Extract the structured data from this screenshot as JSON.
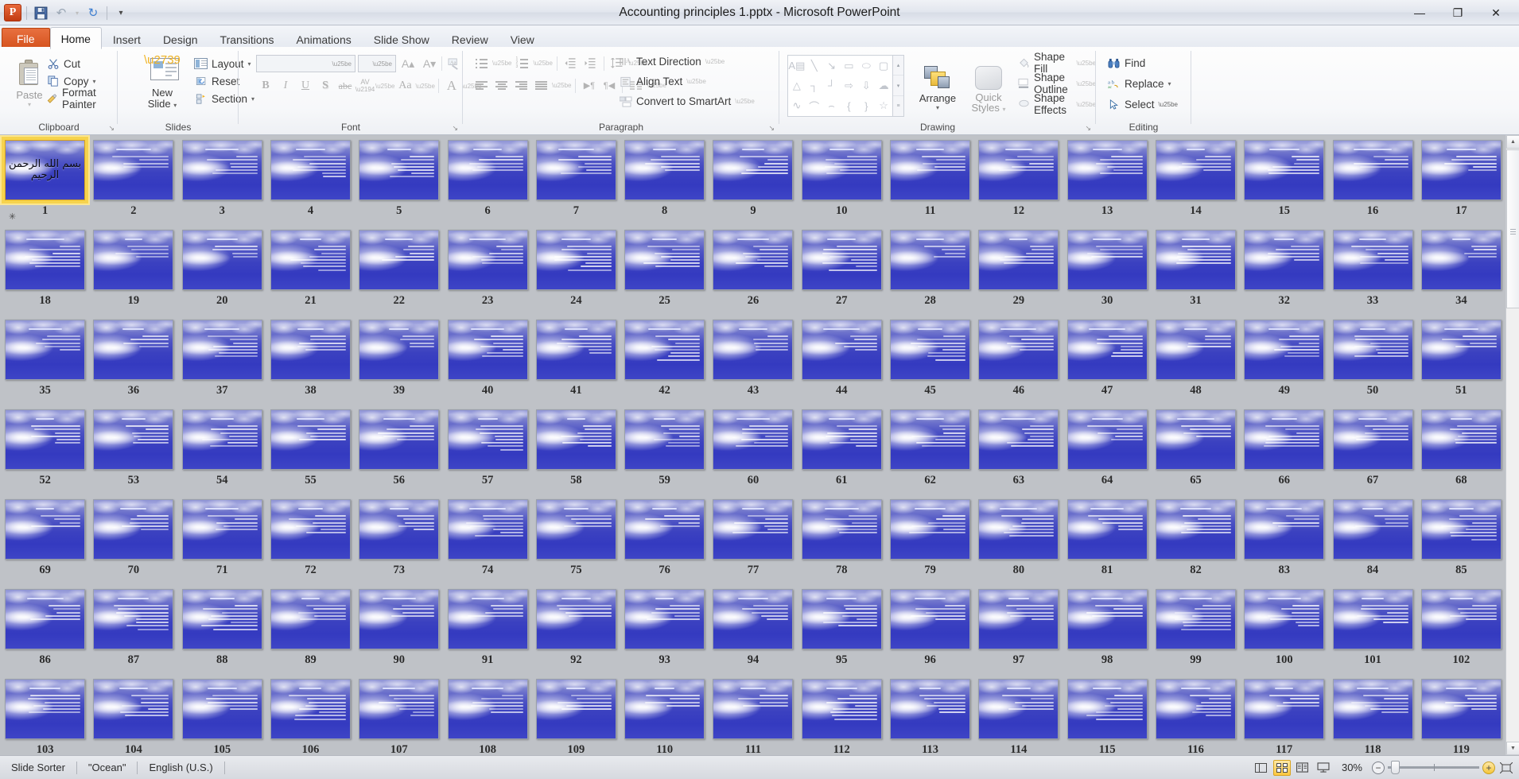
{
  "window": {
    "title": "Accounting principles 1.pptx  -  Microsoft PowerPoint",
    "app_logo": "P",
    "minimize": "—",
    "restore": "❐",
    "close": "✕",
    "ribbon_collapse_icon": "⌃",
    "help_icon": "?"
  },
  "quick_access": {
    "save_icon": "save-icon",
    "undo_icon": "↶",
    "undo_dropdown": "▾",
    "redo_icon": "↻",
    "customize_icon": "▾"
  },
  "tabs": [
    {
      "label": "File",
      "kind": "file"
    },
    {
      "label": "Home",
      "kind": "active"
    },
    {
      "label": "Insert",
      "kind": "normal"
    },
    {
      "label": "Design",
      "kind": "normal"
    },
    {
      "label": "Transitions",
      "kind": "normal"
    },
    {
      "label": "Animations",
      "kind": "normal"
    },
    {
      "label": "Slide Show",
      "kind": "normal"
    },
    {
      "label": "Review",
      "kind": "normal"
    },
    {
      "label": "View",
      "kind": "normal"
    }
  ],
  "ribbon": {
    "clipboard": {
      "group_label": "Clipboard",
      "paste": "Paste",
      "paste_caret": "▾",
      "cut": "Cut",
      "copy": "Copy",
      "copy_caret": "▾",
      "format_painter": "Format Painter",
      "dialog_launcher": "↘"
    },
    "slides": {
      "group_label": "Slides",
      "new_slide_line1": "New",
      "new_slide_line2": "Slide",
      "new_slide_caret": "▾",
      "layout": "Layout",
      "layout_caret": "▾",
      "reset": "Reset",
      "section": "Section",
      "section_caret": "▾"
    },
    "font": {
      "group_label": "Font",
      "font_name_value": "",
      "font_size_value": "",
      "grow_font": "A▴",
      "shrink_font": "A▾",
      "clear_formatting": "clear-formatting-icon",
      "bold": "B",
      "italic": "I",
      "underline": "U",
      "shadow": "S",
      "strikethrough": "abc",
      "character_spacing": "AV",
      "change_case": "Aa",
      "font_color": "A",
      "dialog_launcher": "↘"
    },
    "paragraph": {
      "group_label": "Paragraph",
      "bullets": "bullets-icon",
      "numbering": "numbering-icon",
      "decrease_indent": "decrease-indent-icon",
      "increase_indent": "increase-indent-icon",
      "line_spacing": "line-spacing-icon",
      "align_left": "align-left-icon",
      "align_center": "align-center-icon",
      "align_right": "align-right-icon",
      "justify": "justify-icon",
      "ltr": "▶¶",
      "rtl": "¶◀",
      "columns": "columns-icon",
      "text_direction": "Text Direction",
      "align_text": "Align Text",
      "convert_to_smartart": "Convert to SmartArt",
      "dialog_launcher": "↘"
    },
    "drawing": {
      "group_label": "Drawing",
      "shapes": [
        "A▤",
        "╲",
        "↘",
        "▭",
        "⬭",
        "▢",
        "△",
        "┐",
        "┘",
        "⇨",
        "⇩",
        "☁",
        "∿",
        "⌒",
        "⌢",
        "{",
        "}",
        "☆"
      ],
      "gallery_up": "▴",
      "gallery_down": "▾",
      "gallery_more": "≡",
      "arrange": "Arrange",
      "arrange_caret": "▾",
      "quick_styles_line1": "Quick",
      "quick_styles_line2": "Styles",
      "quick_styles_caret": "▾",
      "shape_fill": "Shape Fill",
      "shape_outline": "Shape Outline",
      "shape_effects": "Shape Effects",
      "caret": "▾",
      "dialog_launcher": "↘"
    },
    "editing": {
      "group_label": "Editing",
      "find": "Find",
      "replace": "Replace",
      "select": "Select",
      "caret": "▾"
    }
  },
  "sorter": {
    "first_slide_number": 1,
    "rows": [
      [
        17,
        16,
        15,
        14,
        13,
        12,
        11,
        10,
        9,
        8,
        7,
        6,
        5,
        4,
        3,
        2,
        1
      ],
      [
        34,
        33,
        32,
        31,
        30,
        29,
        28,
        27,
        26,
        25,
        24,
        23,
        22,
        21,
        20,
        19,
        18
      ],
      [
        51,
        50,
        49,
        48,
        47,
        46,
        45,
        44,
        43,
        42,
        41,
        40,
        39,
        38,
        37,
        36,
        35
      ],
      [
        68,
        67,
        66,
        65,
        64,
        63,
        62,
        61,
        60,
        59,
        58,
        57,
        56,
        55,
        54,
        53,
        52
      ],
      [
        85,
        84,
        83,
        82,
        81,
        80,
        79,
        78,
        77,
        76,
        75,
        74,
        73,
        72,
        71,
        70,
        69
      ],
      [
        102,
        101,
        100,
        99,
        98,
        97,
        96,
        95,
        94,
        93,
        92,
        91,
        90,
        89,
        88,
        87,
        86
      ],
      [
        119,
        118,
        117,
        116,
        115,
        114,
        113,
        112,
        111,
        110,
        109,
        108,
        107,
        106,
        105,
        104,
        103
      ]
    ],
    "selected_slide": 1,
    "selected_slide_content": "بسم الله الرحمن الرحيم",
    "transition_icon": "✳",
    "scroll_up": "▲",
    "scroll_down": "▼"
  },
  "statusbar": {
    "view_name": "Slide Sorter",
    "theme_name": "\"Ocean\"",
    "language": "English (U.S.)",
    "zoom_percent": "30%",
    "zoom_out_icon": "−",
    "zoom_in_icon": "+",
    "fit_to_window_icon": "fit-slide-icon",
    "view_normal": "normal-view-icon",
    "view_slide_sorter": "slide-sorter-view-icon",
    "view_reading": "reading-view-icon",
    "view_slideshow": "slide-show-icon"
  }
}
